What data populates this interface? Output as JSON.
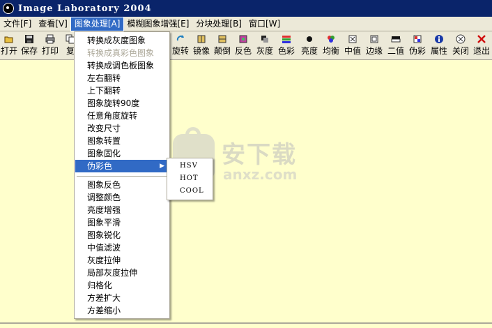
{
  "window": {
    "title": "Image Laboratory 2004"
  },
  "menubar": [
    {
      "label": "文件[F]",
      "active": false
    },
    {
      "label": "查看[V]",
      "active": false
    },
    {
      "label": "图象处理[A]",
      "active": true
    },
    {
      "label": "模糊图象增强[E]",
      "active": false
    },
    {
      "label": "分块处理[B]",
      "active": false
    },
    {
      "label": "窗口[W]",
      "active": false
    }
  ],
  "toolbar": {
    "open": "打开",
    "save": "保存",
    "print": "打印",
    "copy": "复",
    "rotate": "旋转",
    "mirror": "镜像",
    "flip": "颠倒",
    "invert": "反色",
    "gray": "灰度",
    "color": "色彩",
    "brightness": "亮度",
    "equalize": "均衡",
    "median": "中值",
    "edge": "边缘",
    "binary": "二值",
    "pseudo": "伪彩",
    "properties": "属性",
    "close": "关闭",
    "exit": "退出"
  },
  "image_menu": {
    "items": [
      "转换成灰度图象",
      "转换成真彩色图象",
      "转换成调色板图象",
      "左右翻转",
      "上下翻转",
      "图象旋转90度",
      "任意角度旋转",
      "改变尺寸",
      "图象转置",
      "图象固化",
      "伪彩色",
      "图象反色",
      "调整颜色",
      "亮度增强",
      "图象平滑",
      "图象锐化",
      "中值滤波",
      "灰度拉伸",
      "局部灰度拉伸",
      "归格化",
      "方差扩大",
      "方差缩小"
    ]
  },
  "pseudo_color_submenu": [
    "HSV",
    "HOT",
    "COOL"
  ],
  "watermark": {
    "text": "安下载",
    "url": "anxz.com"
  },
  "colors": {
    "menu_highlight": "#316AC5",
    "workspace": "#FFFFCC",
    "chrome": "#ECE9D8",
    "titlebar": "#0A246A"
  }
}
